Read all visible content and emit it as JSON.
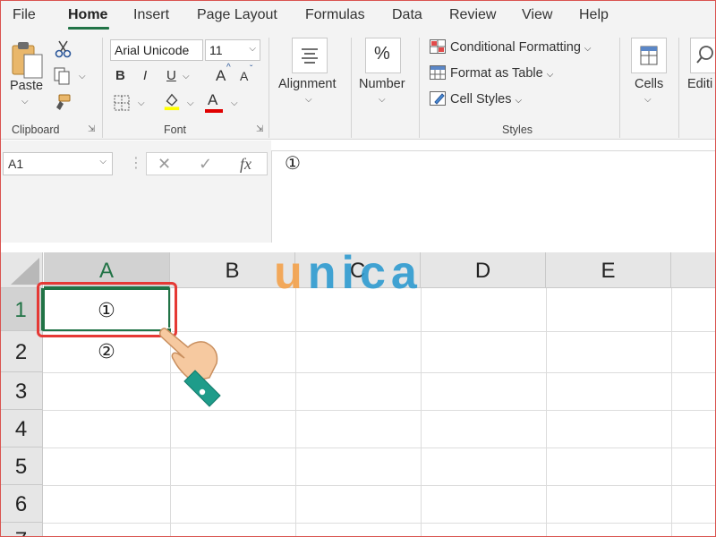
{
  "menu": {
    "tabs": [
      {
        "label": "File"
      },
      {
        "label": "Home"
      },
      {
        "label": "Insert"
      },
      {
        "label": "Page Layout"
      },
      {
        "label": "Formulas"
      },
      {
        "label": "Data"
      },
      {
        "label": "Review"
      },
      {
        "label": "View"
      },
      {
        "label": "Help"
      }
    ],
    "active_tab": "Home"
  },
  "ribbon": {
    "clipboard": {
      "paste_label": "Paste",
      "group_label": "Clipboard"
    },
    "font": {
      "font_name": "Arial Unicode",
      "font_size": "11",
      "bold": "B",
      "italic": "I",
      "underline": "U",
      "grow": "A",
      "shrink": "A",
      "font_color_glyph": "A",
      "group_label": "Font"
    },
    "alignment": {
      "label": "Alignment"
    },
    "number": {
      "icon_glyph": "%",
      "label": "Number"
    },
    "styles": {
      "items": [
        {
          "label": "Conditional Formatting"
        },
        {
          "label": "Format as Table"
        },
        {
          "label": "Cell Styles"
        }
      ],
      "group_label": "Styles"
    },
    "cells": {
      "label": "Cells"
    },
    "editing": {
      "label": "Editi"
    }
  },
  "formula_bar": {
    "name_box": "A1",
    "cancel_glyph": "✕",
    "enter_glyph": "✓",
    "fx_glyph": "fx",
    "value": "①"
  },
  "sheet": {
    "columns": [
      "A",
      "B",
      "C",
      "D",
      "E"
    ],
    "rows": [
      "1",
      "2",
      "3",
      "4",
      "5",
      "6",
      "7"
    ],
    "selected_cell": "A1",
    "cells": {
      "A1": "①",
      "A2": "②"
    }
  },
  "watermark": {
    "letters": [
      "u",
      "n",
      "i",
      "c",
      "a"
    ]
  },
  "colors": {
    "excel_green": "#217346",
    "highlight_red": "#e53935",
    "logo_orange": "#f4a24b",
    "logo_blue": "#2f9bd0"
  }
}
